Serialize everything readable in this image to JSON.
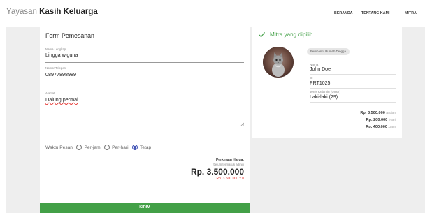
{
  "header": {
    "brand_light": "Yayasan",
    "brand_bold": "Kasih Keluarga",
    "nav": [
      "BERANDA",
      "TENTANG KAMI",
      "MITRA"
    ]
  },
  "form": {
    "title": "Form Pemesanan",
    "name_label": "Nama Lengkap",
    "name_value": "Lingga wiguna",
    "phone_label": "Nomor Telepon",
    "phone_value": "08977898989",
    "address_label": "Alamat",
    "address_value": "Dalung permai",
    "waktu_label": "Waktu Pesan",
    "options": [
      {
        "label": "Per-jam",
        "checked": false
      },
      {
        "label": "Per-hari",
        "checked": false
      },
      {
        "label": "Tetap",
        "checked": true
      }
    ],
    "estimate_label": "Perkiraan Harga:",
    "estimate_note": "*belum termasuk admin",
    "estimate_total": "Rp. 3.500.000",
    "estimate_calc": "Rp. 3.500.000 x 0",
    "submit_label": "KIRIM"
  },
  "mitra": {
    "heading": "Mitra yang dipilih",
    "category": "Pembantu Rumah Tangga",
    "name_label": "Nama",
    "name_value": "John Doe",
    "id_label": "ID",
    "id_value": "PRT1025",
    "gender_label": "Jenis Kelamin (Umur)",
    "gender_value": "Laki-laki (29)",
    "rates": [
      {
        "amount": "Rp. 3.500.000",
        "unit": "/Bulan"
      },
      {
        "amount": "Rp. 200.000",
        "unit": "/Hari"
      },
      {
        "amount": "Rp. 400.000",
        "unit": "/Jam"
      }
    ]
  },
  "colors": {
    "accent_green": "#43a047",
    "radio_selected": "#3f51b5",
    "price_red": "#e53935"
  },
  "icons": {
    "selected_check": "check-icon",
    "avatar": "cat-photo"
  }
}
